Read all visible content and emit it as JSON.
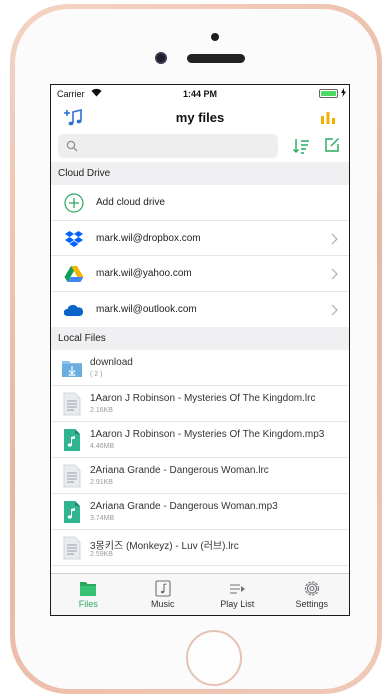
{
  "status_bar": {
    "carrier": "Carrier",
    "time": "1:44 PM",
    "battery_level": 1.0
  },
  "nav": {
    "title": "my files"
  },
  "search": {
    "placeholder": ""
  },
  "cloud_section": {
    "title": "Cloud Drive",
    "items": [
      {
        "label": "Add cloud drive",
        "icon": "add-circle-icon"
      },
      {
        "label": "mark.wil@dropbox.com",
        "icon": "dropbox-icon"
      },
      {
        "label": "mark.wil@yahoo.com",
        "icon": "google-drive-icon"
      },
      {
        "label": "mark.wil@outlook.com",
        "icon": "onedrive-icon"
      }
    ]
  },
  "local_section": {
    "title": "Local Files",
    "items": [
      {
        "name": "download",
        "meta": "( 2 )",
        "icon": "folder-icon"
      },
      {
        "name": "1Aaron J Robinson - Mysteries Of The Kingdom.lrc",
        "meta": "2.16KB",
        "icon": "document-icon"
      },
      {
        "name": "1Aaron J Robinson - Mysteries Of The Kingdom.mp3",
        "meta": "4.46MB",
        "icon": "music-file-icon"
      },
      {
        "name": "2Ariana Grande - Dangerous Woman.lrc",
        "meta": "2.91KB",
        "icon": "document-icon"
      },
      {
        "name": "2Ariana Grande - Dangerous Woman.mp3",
        "meta": "3.74MB",
        "icon": "music-file-icon"
      },
      {
        "name": "3몽키즈 (Monkeyz) - Luv (러브).lrc",
        "meta": "2.59KB",
        "icon": "document-icon"
      }
    ]
  },
  "tabs": [
    {
      "label": "Files",
      "icon": "folder-tab-icon",
      "active": true
    },
    {
      "label": "Music",
      "icon": "music-tab-icon",
      "active": false
    },
    {
      "label": "Play List",
      "icon": "playlist-tab-icon",
      "active": false
    },
    {
      "label": "Settings",
      "icon": "settings-tab-icon",
      "active": false
    }
  ],
  "colors": {
    "accent": "#2aa860",
    "nav_icon": "#2e6fd8",
    "equalizer": "#f0b000",
    "dropbox": "#0061fe",
    "onedrive": "#0a64c8",
    "folder": "#6aaee0"
  }
}
